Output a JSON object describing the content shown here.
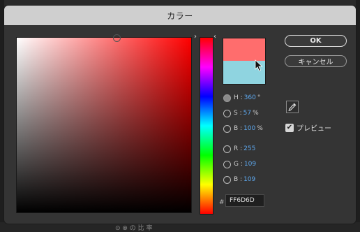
{
  "dialog": {
    "title": "カラー"
  },
  "buttons": {
    "ok": "OK",
    "cancel": "キャンセル"
  },
  "color": {
    "new_hex_color": "#ff6d6d",
    "old_hex_color": "#8fd4e0",
    "saturation_fraction": 0.57,
    "brightness_fraction": 1.0
  },
  "fields": {
    "h": {
      "label": "H :",
      "value": "360",
      "unit": "°"
    },
    "s": {
      "label": "S :",
      "value": "57",
      "unit": "%"
    },
    "b": {
      "label": "B :",
      "value": "100",
      "unit": "%"
    },
    "r": {
      "label": "R :",
      "value": "255"
    },
    "g": {
      "label": "G :",
      "value": "109"
    },
    "b2": {
      "label": "B :",
      "value": "109"
    }
  },
  "hex": {
    "prefix": "#",
    "value": "FF6D6D"
  },
  "preview": {
    "label": "プレビュー",
    "checked": true
  },
  "icons": {
    "eyedropper": "eyedropper-icon",
    "hue_left": "chevron-right-icon",
    "hue_right": "chevron-left-icon"
  },
  "background": {
    "bottom_text": "⊙ ⊗ の 比 率"
  }
}
